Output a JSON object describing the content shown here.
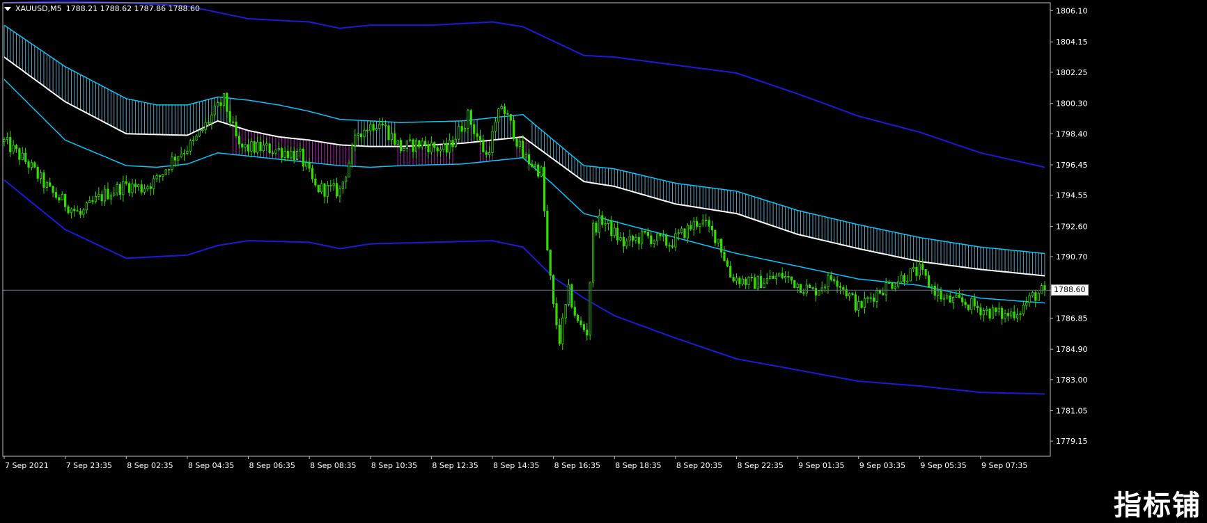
{
  "header": {
    "symbol": "XAUUSD,M5",
    "ohlc": "1788.21 1788.62 1787.86 1788.60"
  },
  "current_price": "1788.60",
  "watermark": "指标铺",
  "colors": {
    "background": "#000000",
    "axis": "#c0c0c0",
    "candle": "#33dd00",
    "outer_band": "#1a1adb",
    "inner_band": "#00c8ff",
    "middle_line": "#ffffff",
    "cloud_up": "#7fd8ff",
    "cloud_down": "#b027b0",
    "price_line": "#6a7a8a"
  },
  "chart_data": {
    "type": "line",
    "title": "",
    "xlabel": "",
    "ylabel": "",
    "ylim": [
      1778.2,
      1806.6
    ],
    "y_ticks": [
      1806.1,
      1804.15,
      1802.25,
      1800.3,
      1798.4,
      1796.45,
      1794.55,
      1792.6,
      1790.7,
      1788.6,
      1786.85,
      1784.9,
      1783.0,
      1781.05,
      1779.15
    ],
    "x_ticks": [
      "7 Sep 2021",
      "7 Sep 23:35",
      "8 Sep 02:35",
      "8 Sep 04:35",
      "8 Sep 06:35",
      "8 Sep 08:35",
      "8 Sep 10:35",
      "8 Sep 12:35",
      "8 Sep 14:35",
      "8 Sep 16:35",
      "8 Sep 18:35",
      "8 Sep 20:35",
      "8 Sep 22:35",
      "9 Sep 01:35",
      "9 Sep 03:35",
      "9 Sep 05:35",
      "9 Sep 07:35"
    ],
    "x_tick_bars": [
      0,
      20,
      40,
      60,
      80,
      100,
      120,
      140,
      160,
      180,
      200,
      220,
      240,
      260,
      280,
      300,
      320
    ],
    "n_bars": 342,
    "grid": false,
    "series": [
      {
        "role": "close",
        "points": [
          [
            0,
            1797.9
          ],
          [
            8,
            1796.5
          ],
          [
            15,
            1794.8
          ],
          [
            25,
            1793.3
          ],
          [
            30,
            1794.2
          ],
          [
            33,
            1794.6
          ],
          [
            40,
            1795.2
          ],
          [
            45,
            1795.0
          ],
          [
            50,
            1795.5
          ],
          [
            56,
            1797.0
          ],
          [
            62,
            1797.8
          ],
          [
            68,
            1799.5
          ],
          [
            72,
            1800.5
          ],
          [
            77,
            1797.5
          ],
          [
            85,
            1797.5
          ],
          [
            92,
            1797.3
          ],
          [
            97,
            1797.0
          ],
          [
            102,
            1795.0
          ],
          [
            110,
            1794.8
          ],
          [
            116,
            1798.5
          ],
          [
            123,
            1799.2
          ],
          [
            130,
            1797.5
          ],
          [
            137,
            1797.8
          ],
          [
            145,
            1797.3
          ],
          [
            152,
            1799.5
          ],
          [
            158,
            1797.0
          ],
          [
            163,
            1800.2
          ],
          [
            167,
            1798.5
          ],
          [
            170,
            1797.0
          ],
          [
            176,
            1796.0
          ],
          [
            178,
            1791.0
          ],
          [
            180,
            1787.5
          ],
          [
            182,
            1785.5
          ],
          [
            185,
            1788.5
          ],
          [
            188,
            1786.5
          ],
          [
            191,
            1786.0
          ],
          [
            193,
            1792.5
          ],
          [
            196,
            1793.0
          ],
          [
            203,
            1791.5
          ],
          [
            210,
            1792.0
          ],
          [
            218,
            1791.5
          ],
          [
            228,
            1793.0
          ],
          [
            234,
            1791.8
          ],
          [
            238,
            1789.5
          ],
          [
            245,
            1789.0
          ],
          [
            255,
            1789.5
          ],
          [
            265,
            1788.5
          ],
          [
            272,
            1789.5
          ],
          [
            280,
            1787.5
          ],
          [
            286,
            1788.5
          ],
          [
            295,
            1789.5
          ],
          [
            300,
            1789.8
          ],
          [
            303,
            1789.0
          ],
          [
            308,
            1788.0
          ],
          [
            315,
            1787.8
          ],
          [
            322,
            1787.3
          ],
          [
            328,
            1787.0
          ],
          [
            333,
            1787.4
          ],
          [
            337,
            1788.2
          ],
          [
            341,
            1788.6
          ]
        ]
      },
      {
        "role": "middle",
        "points": [
          [
            0,
            1803.2
          ],
          [
            20,
            1800.4
          ],
          [
            40,
            1798.4
          ],
          [
            60,
            1798.3
          ],
          [
            70,
            1799.2
          ],
          [
            80,
            1798.6
          ],
          [
            90,
            1798.2
          ],
          [
            100,
            1798.0
          ],
          [
            110,
            1797.7
          ],
          [
            120,
            1797.6
          ],
          [
            130,
            1797.6
          ],
          [
            150,
            1797.8
          ],
          [
            170,
            1798.2
          ],
          [
            180,
            1796.8
          ],
          [
            190,
            1795.4
          ],
          [
            200,
            1795.1
          ],
          [
            220,
            1794.0
          ],
          [
            240,
            1793.4
          ],
          [
            260,
            1792.1
          ],
          [
            280,
            1791.2
          ],
          [
            300,
            1790.4
          ],
          [
            320,
            1789.9
          ],
          [
            341,
            1789.5
          ]
        ]
      },
      {
        "role": "inner_upper",
        "points": [
          [
            0,
            1805.2
          ],
          [
            20,
            1802.6
          ],
          [
            40,
            1800.6
          ],
          [
            50,
            1800.2
          ],
          [
            60,
            1800.2
          ],
          [
            70,
            1800.7
          ],
          [
            80,
            1800.5
          ],
          [
            90,
            1800.2
          ],
          [
            100,
            1799.8
          ],
          [
            110,
            1799.3
          ],
          [
            120,
            1799.2
          ],
          [
            130,
            1799.1
          ],
          [
            150,
            1799.2
          ],
          [
            170,
            1799.6
          ],
          [
            180,
            1798.0
          ],
          [
            190,
            1796.4
          ],
          [
            200,
            1796.2
          ],
          [
            220,
            1795.3
          ],
          [
            240,
            1794.8
          ],
          [
            260,
            1793.6
          ],
          [
            280,
            1792.7
          ],
          [
            300,
            1791.9
          ],
          [
            320,
            1791.3
          ],
          [
            341,
            1790.9
          ]
        ]
      },
      {
        "role": "inner_lower",
        "points": [
          [
            0,
            1801.8
          ],
          [
            20,
            1798.0
          ],
          [
            40,
            1796.4
          ],
          [
            50,
            1796.3
          ],
          [
            60,
            1796.5
          ],
          [
            70,
            1797.2
          ],
          [
            80,
            1797.0
          ],
          [
            90,
            1796.8
          ],
          [
            100,
            1796.6
          ],
          [
            110,
            1796.4
          ],
          [
            120,
            1796.3
          ],
          [
            130,
            1796.4
          ],
          [
            150,
            1796.5
          ],
          [
            170,
            1796.9
          ],
          [
            180,
            1795.2
          ],
          [
            190,
            1793.4
          ],
          [
            200,
            1792.9
          ],
          [
            220,
            1791.9
          ],
          [
            240,
            1790.9
          ],
          [
            260,
            1790.1
          ],
          [
            280,
            1789.3
          ],
          [
            300,
            1788.9
          ],
          [
            320,
            1788.1
          ],
          [
            341,
            1787.8
          ]
        ]
      },
      {
        "role": "outer_upper",
        "points": [
          [
            0,
            1806.6
          ],
          [
            20,
            1806.7
          ],
          [
            40,
            1806.6
          ],
          [
            60,
            1806.4
          ],
          [
            70,
            1806.0
          ],
          [
            80,
            1805.6
          ],
          [
            100,
            1805.4
          ],
          [
            110,
            1805.0
          ],
          [
            120,
            1805.2
          ],
          [
            140,
            1805.2
          ],
          [
            160,
            1805.4
          ],
          [
            170,
            1805.1
          ],
          [
            180,
            1804.2
          ],
          [
            190,
            1803.3
          ],
          [
            200,
            1803.2
          ],
          [
            220,
            1802.7
          ],
          [
            240,
            1802.2
          ],
          [
            260,
            1800.9
          ],
          [
            280,
            1799.5
          ],
          [
            300,
            1798.5
          ],
          [
            320,
            1797.2
          ],
          [
            341,
            1796.3
          ]
        ]
      },
      {
        "role": "outer_lower",
        "points": [
          [
            0,
            1795.5
          ],
          [
            20,
            1792.4
          ],
          [
            40,
            1790.6
          ],
          [
            60,
            1790.8
          ],
          [
            70,
            1791.4
          ],
          [
            80,
            1791.7
          ],
          [
            100,
            1791.6
          ],
          [
            110,
            1791.2
          ],
          [
            120,
            1791.5
          ],
          [
            140,
            1791.6
          ],
          [
            160,
            1791.7
          ],
          [
            170,
            1791.3
          ],
          [
            180,
            1789.4
          ],
          [
            190,
            1788.1
          ],
          [
            200,
            1787.0
          ],
          [
            220,
            1785.6
          ],
          [
            240,
            1784.3
          ],
          [
            260,
            1783.6
          ],
          [
            280,
            1782.9
          ],
          [
            300,
            1782.6
          ],
          [
            320,
            1782.2
          ],
          [
            341,
            1782.1
          ]
        ]
      }
    ]
  }
}
